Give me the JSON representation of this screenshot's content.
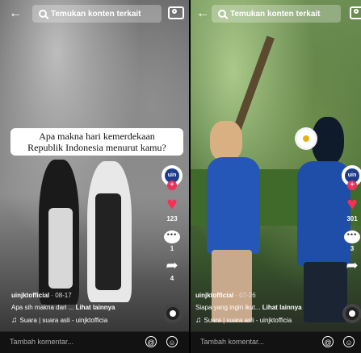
{
  "left": {
    "search_text": "Temukan konten terkait",
    "caption_card": [
      "Apa makna hari kemerdekaan",
      "Republik Indonesia menurut kamu?"
    ],
    "avatar_text": "uin",
    "likes": "123",
    "comments": "1",
    "shares": "4",
    "username": "uinjktofficial",
    "date": "· 08-17",
    "description": "Apa sih makna dari ...",
    "more_label": "Lihat lainnya",
    "sound": "Suara | suara asli - uinjktofficia",
    "comment_placeholder": "Tambah komentar..."
  },
  "right": {
    "search_text": "Temukan konten terkait",
    "avatar_text": "uin",
    "likes": "301",
    "comments": "3",
    "username": "uinjktofficial",
    "date": "· 07-26",
    "description": "Siapa yang ingin ikut...",
    "more_label": "Lihat lainnya",
    "sound": "Suara | suara asli - uinjktofficia",
    "comment_placeholder": "Tambah komentar..."
  },
  "icons": {
    "back": "←",
    "heart": "♥",
    "share": "➦",
    "note": "♫",
    "at": "@",
    "emoji": "☺"
  }
}
